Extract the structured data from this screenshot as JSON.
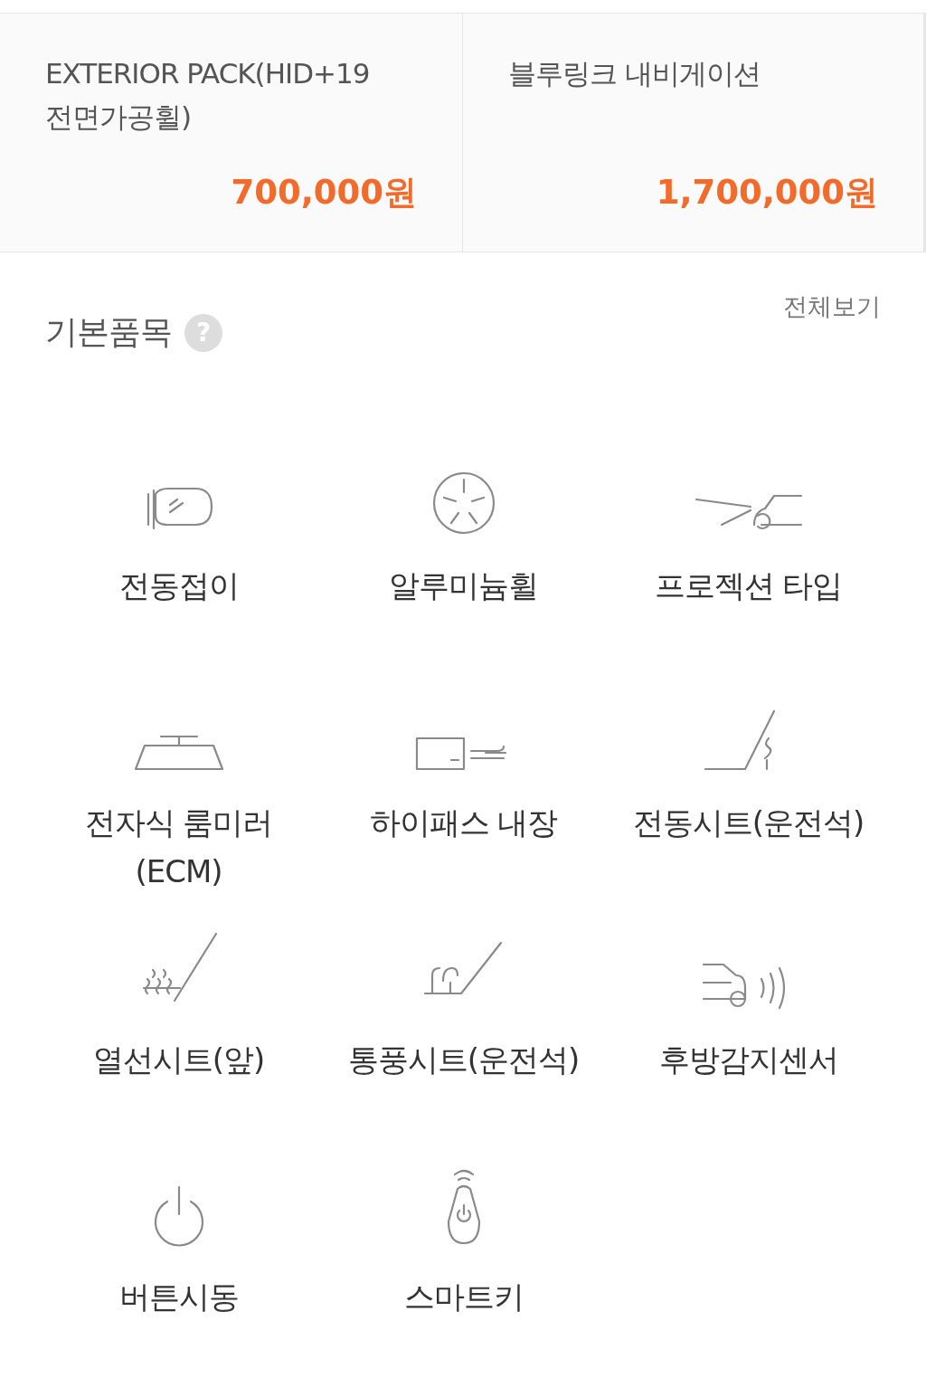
{
  "packages": [
    {
      "name": "EXTERIOR PACK(HID+19 전면가공휠)",
      "price": "700,000원"
    },
    {
      "name": "블루링크 내비게이션",
      "price": "1,700,000원"
    }
  ],
  "basic_items": {
    "title": "기본품목",
    "help": "?",
    "view_all": "전체보기",
    "items": [
      {
        "label": "전동접이"
      },
      {
        "label": "알루미늄휠"
      },
      {
        "label": "프로젝션 타입"
      },
      {
        "label": "전자식 룸미러(ECM)"
      },
      {
        "label": "하이패스 내장"
      },
      {
        "label": "전동시트(운전석)"
      },
      {
        "label": "열선시트(앞)"
      },
      {
        "label": "통풍시트(운전석)"
      },
      {
        "label": "후방감지센서"
      },
      {
        "label": "버튼시동"
      },
      {
        "label": "스마트키"
      }
    ]
  }
}
